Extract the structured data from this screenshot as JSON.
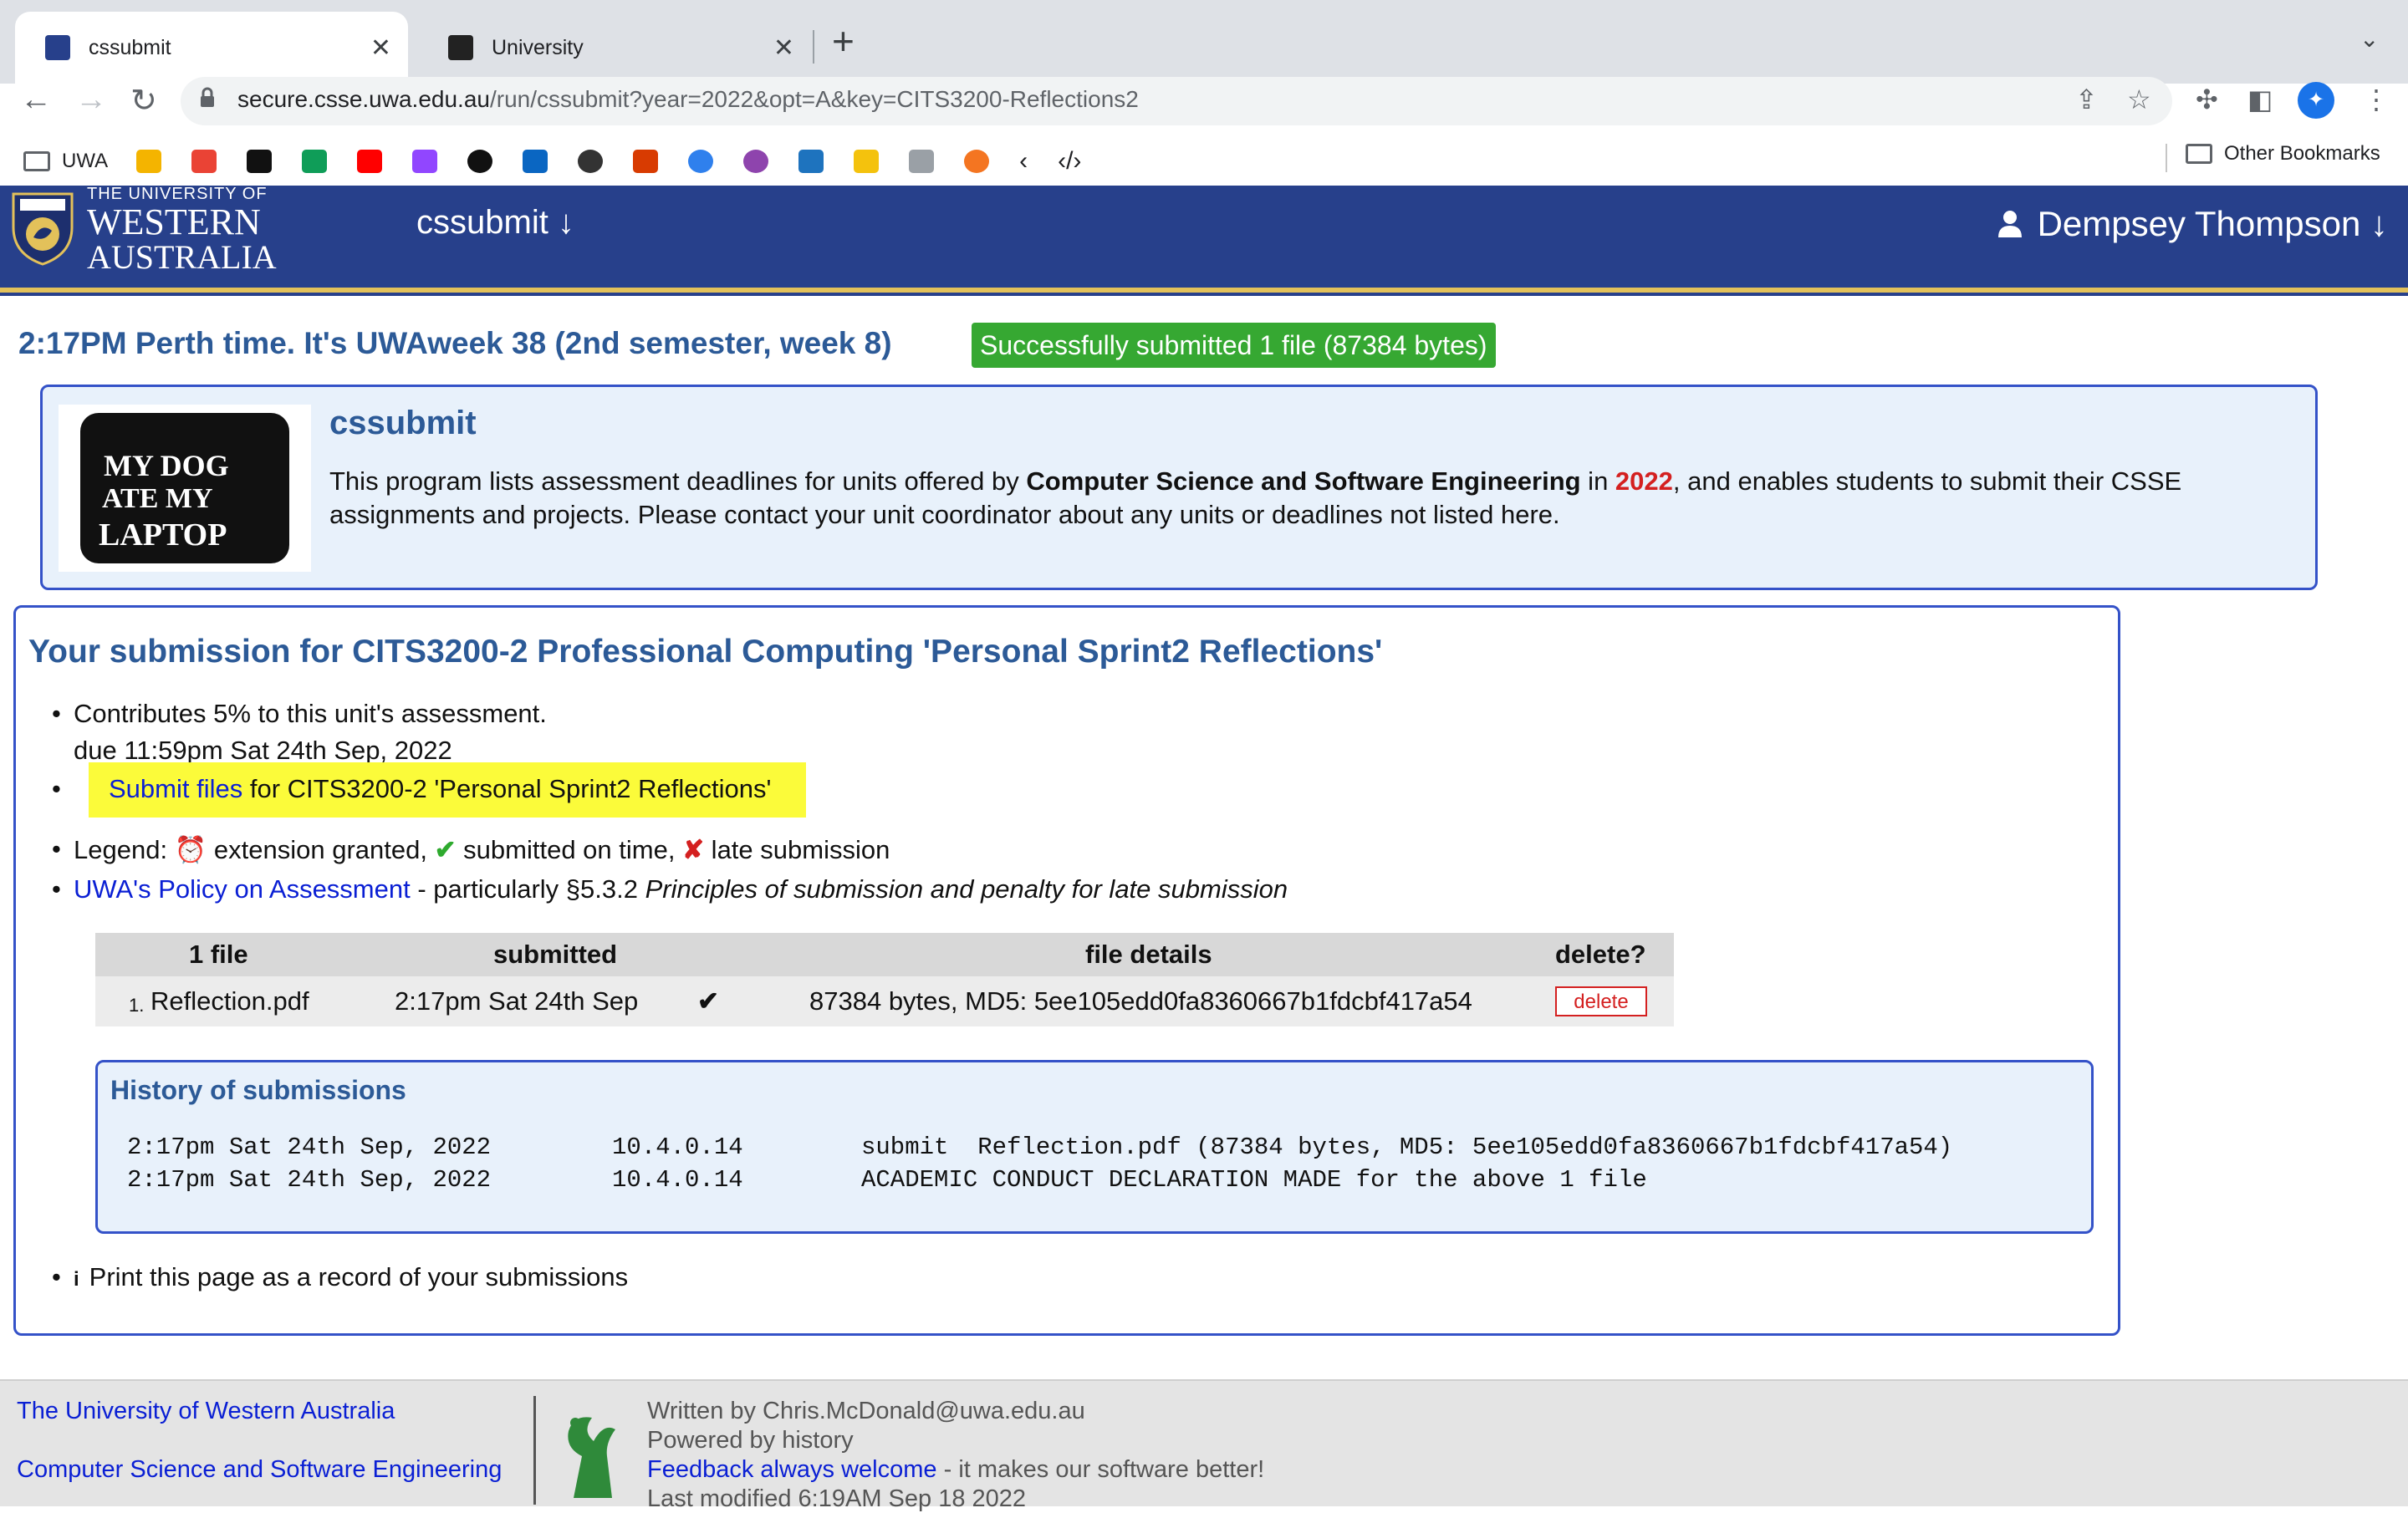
{
  "browser": {
    "tabs": [
      {
        "title": "cssubmit",
        "active": true
      },
      {
        "title": "University",
        "active": false
      }
    ],
    "url_host": "secure.csse.uwa.edu.au",
    "url_path": "/run/cssubmit?year=2022&opt=A&key=CITS3200-Reflections2",
    "bookmarks": [
      {
        "label": "UWA",
        "icon": "folder-icon"
      },
      {
        "label": "",
        "icon": "pencil-icon",
        "color": "#f4b400"
      },
      {
        "label": "",
        "icon": "gmail-icon",
        "color": "#ea4335"
      },
      {
        "label": "",
        "icon": "notion-icon",
        "color": "#111111"
      },
      {
        "label": "",
        "icon": "plus-icon",
        "color": "#0f9d58"
      },
      {
        "label": "",
        "icon": "youtube-icon",
        "color": "#ff0000"
      },
      {
        "label": "",
        "icon": "twitch-icon",
        "color": "#9146ff"
      },
      {
        "label": "",
        "icon": "github-icon",
        "color": "#111111"
      },
      {
        "label": "",
        "icon": "linkedin-icon",
        "color": "#0a66c2"
      },
      {
        "label": "",
        "icon": "app-icon",
        "color": "#333333"
      },
      {
        "label": "",
        "icon": "office-icon",
        "color": "#d83b01"
      },
      {
        "label": "",
        "icon": "c-icon",
        "color": "#2f80ed"
      },
      {
        "label": "",
        "icon": "u-icon",
        "color": "#8e44ad"
      },
      {
        "label": "",
        "icon": "video-icon",
        "color": "#1e73be"
      },
      {
        "label": "",
        "icon": "pen-icon",
        "color": "#f4c20d"
      },
      {
        "label": "",
        "icon": "app-icon",
        "color": "#5f6368"
      },
      {
        "label": "",
        "icon": "crunchyroll-icon",
        "color": "#f47521"
      },
      {
        "label": "",
        "icon": "code-icon",
        "color": "#202124"
      },
      {
        "label": "",
        "icon": "devtools-icon",
        "color": "#202124"
      }
    ],
    "other_bookmarks": "Other Bookmarks"
  },
  "header": {
    "uwa_line1": "THE UNIVERSITY OF",
    "uwa_line2": "WESTERN",
    "uwa_line3": "AUSTRALIA",
    "app_menu": "cssubmit ↓",
    "user_menu": "Dempsey Thompson ↓"
  },
  "status": {
    "perth_time": "2:17PM Perth time.  It's UWAweek 38 (2nd semester, week 8)",
    "success_message": "Successfully submitted 1 file (87384 bytes)"
  },
  "intro": {
    "logo_line1": "MY DOG",
    "logo_line2": "ATE MY",
    "logo_line3": "LAPTOP",
    "title": "cssubmit",
    "text_a": "This program lists assessment deadlines for units offered by ",
    "text_school": "Computer Science and Software Engineering",
    "text_in": " in ",
    "text_year": "2022",
    "text_b": ", and enables students to submit their CSSE assignments and projects. Please contact your unit coordinator about any units or deadlines not listed here."
  },
  "submission": {
    "title": "Your submission for CITS3200-2 Professional Computing 'Personal Sprint2 Reflections'",
    "contributes": "Contributes 5% to this unit's assessment.",
    "due": "due 11:59pm Sat 24th Sep, 2022",
    "submit_link": "Submit files",
    "submit_rest": " for CITS3200-2 'Personal Sprint2 Reflections'",
    "legend_label": "Legend: ",
    "legend_clock": "⏰",
    "legend_ext": " extension granted, ",
    "legend_check": "✔",
    "legend_ontime": " submitted on time, ",
    "legend_cross": "✘",
    "legend_late": " late submission",
    "policy_link": "UWA's Policy on Assessment",
    "policy_rest": " - particularly §5.3.2 ",
    "policy_italic": "Principles of submission and penalty for late submission",
    "table": {
      "headers": [
        "1 file",
        "submitted",
        "file details",
        "delete?"
      ],
      "row": {
        "num": "1.",
        "file": "Reflection.pdf",
        "submitted": "2:17pm Sat 24th Sep",
        "ontime": "✔",
        "details": "87384 bytes,  MD5: 5ee105edd0fa8360667b1fdcbf417a54",
        "delete": "delete"
      }
    },
    "history": {
      "title": "History of submissions",
      "rows": [
        {
          "when": "2:17pm Sat 24th Sep, 2022",
          "ip": "10.4.0.14",
          "action": "submit  Reflection.pdf (87384 bytes, MD5: 5ee105edd0fa8360667b1fdcbf417a54)"
        },
        {
          "when": "2:17pm Sat 24th Sep, 2022",
          "ip": "10.4.0.14",
          "action": "ACADEMIC CONDUCT DECLARATION MADE for the above 1 file"
        }
      ]
    },
    "print_info": "i",
    "print_text": "Print this page as a record of your submissions"
  },
  "footer": {
    "uwa_link": "The University of Western Australia",
    "csse_link": "Computer Science and Software Engineering",
    "written_by": "Written by Chris.McDonald@uwa.edu.au",
    "powered_by": "Powered by history",
    "feedback_link": "Feedback always welcome",
    "feedback_rest": " - it makes our software better!",
    "last_modified": "Last modified  6:19AM Sep 18 2022"
  },
  "colors": {
    "header_blue": "#27408b",
    "heading_blue": "#2c5a97",
    "success_green": "#36a832",
    "link_blue": "#0a1fd4",
    "highlight_yellow": "#fbfb3a",
    "error_red": "#d42020"
  }
}
